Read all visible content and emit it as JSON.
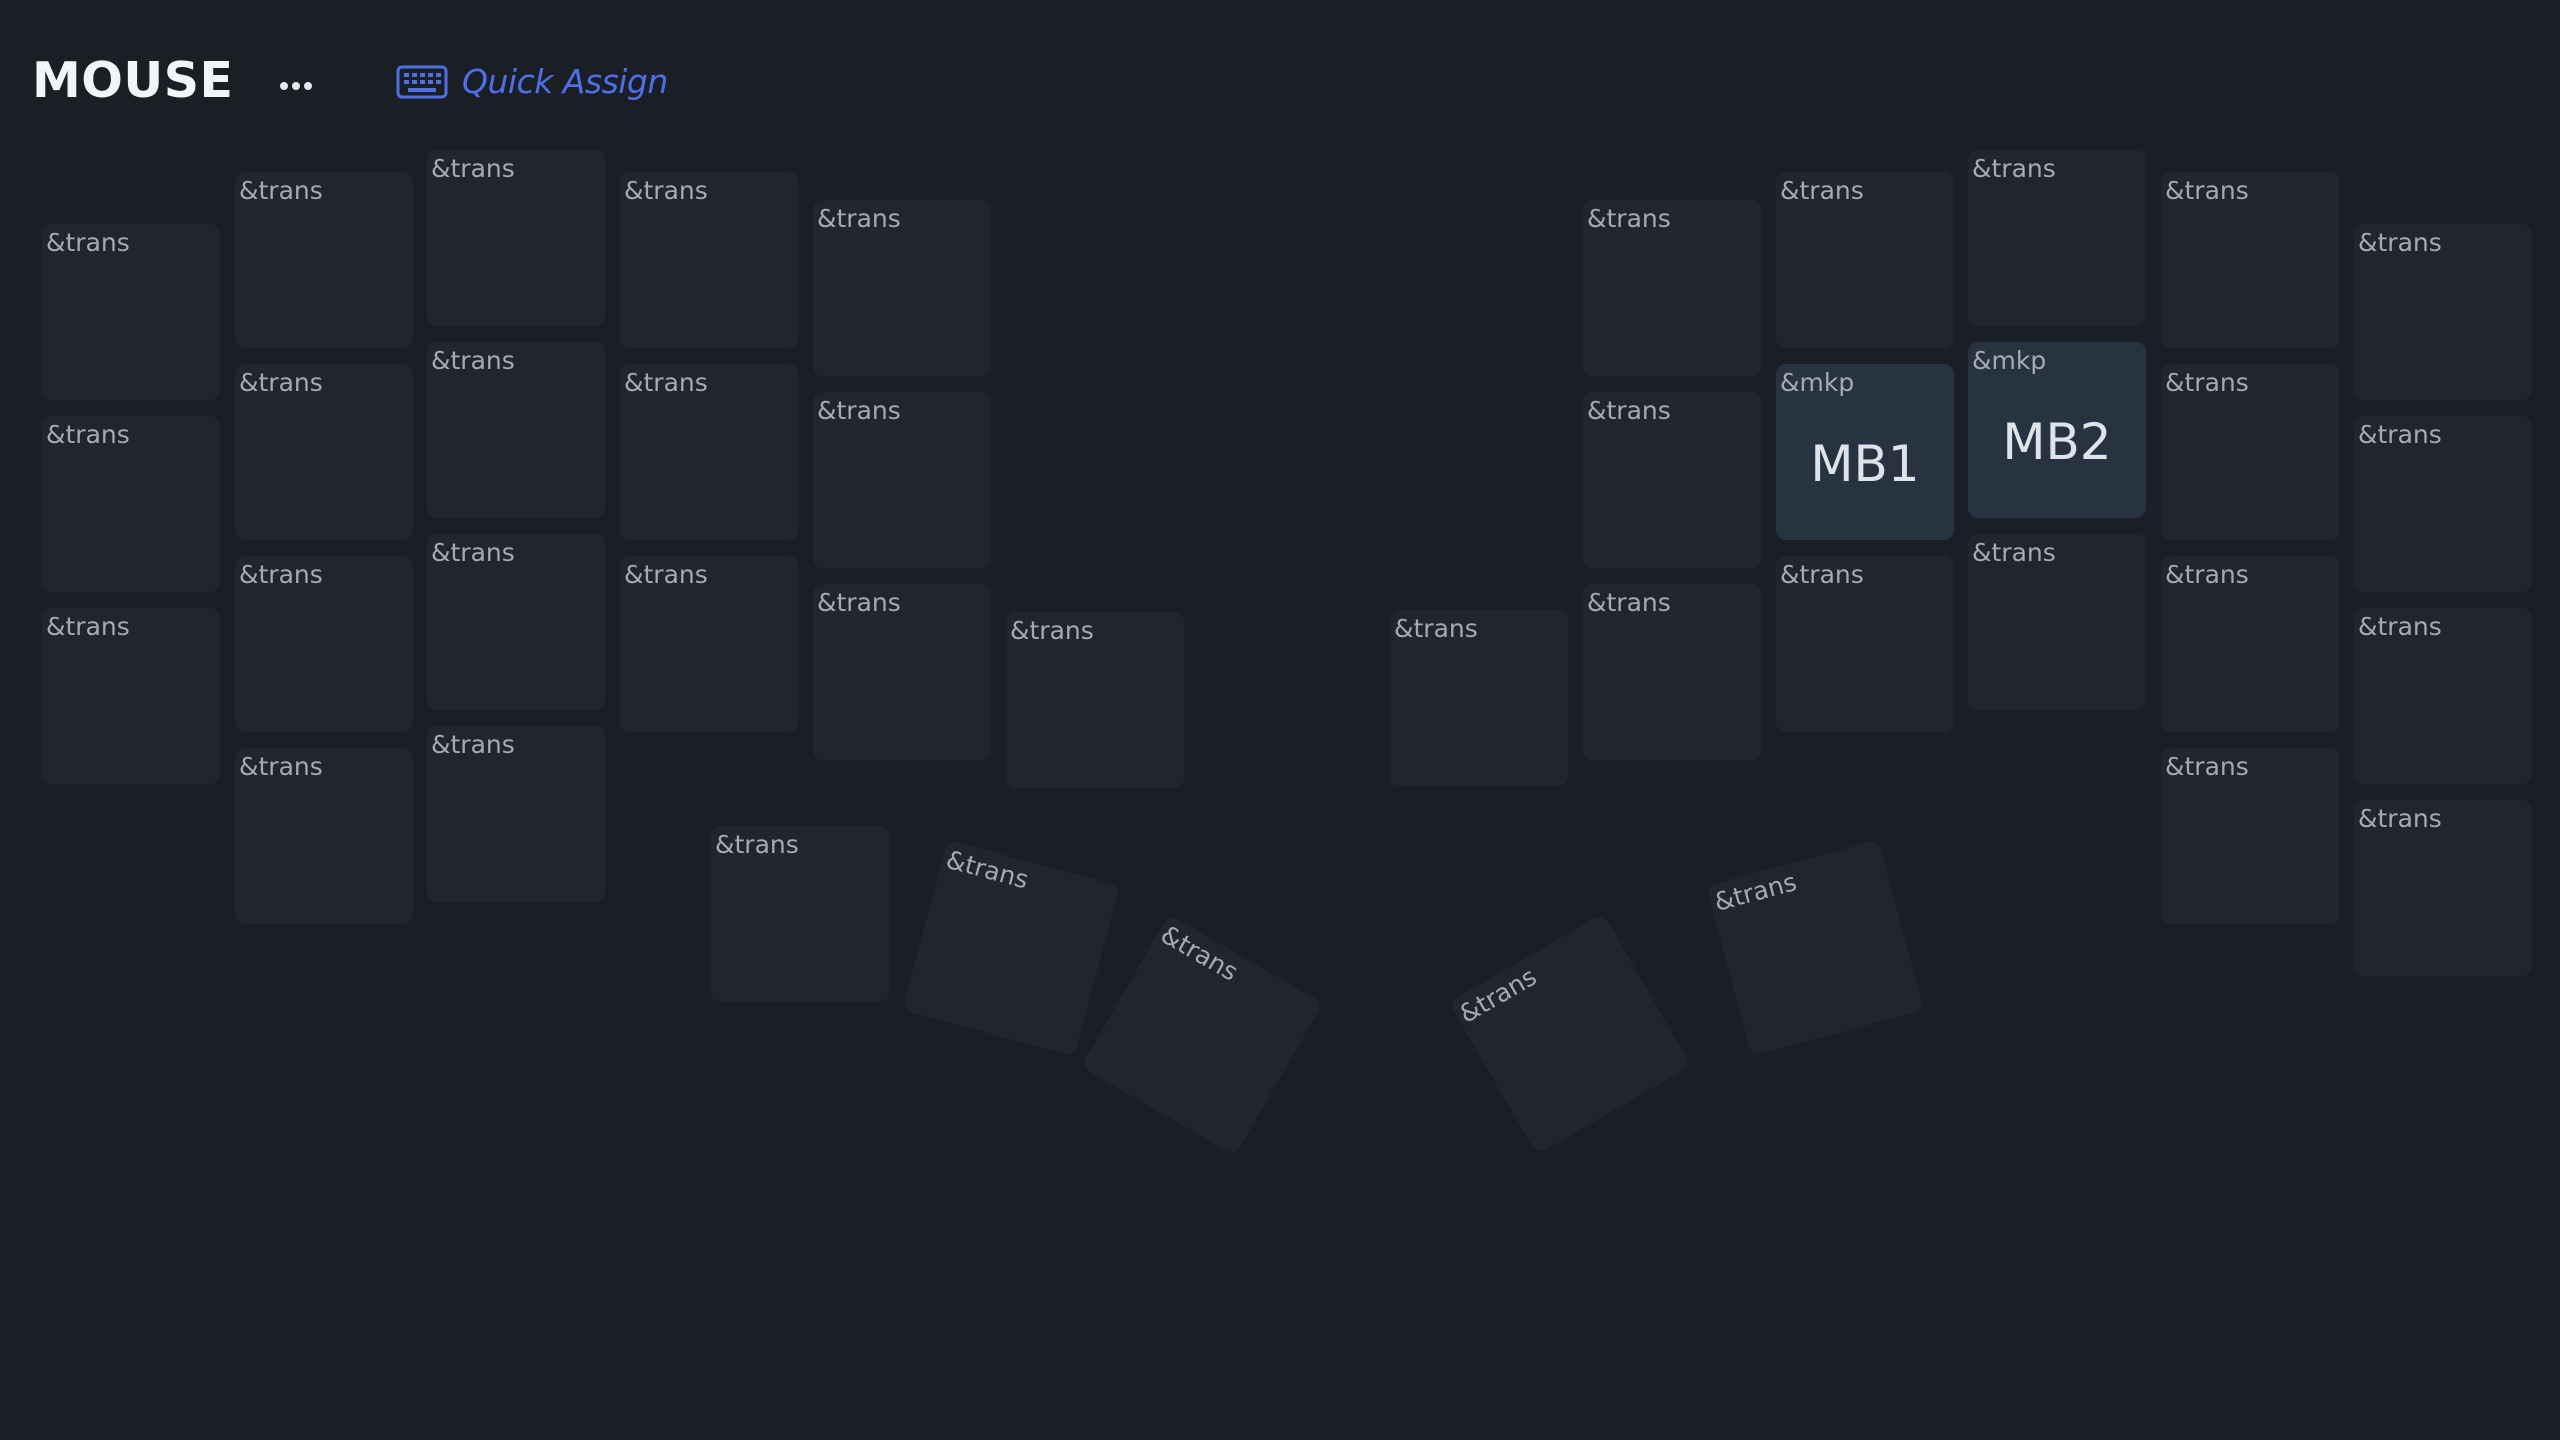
{
  "layer": {
    "name": "MOUSE",
    "more_icon": "ellipsis-icon",
    "quick_assign_label": "Quick Assign",
    "quick_assign_icon": "keyboard-icon",
    "accent_color": "#4f6fe8"
  },
  "keys": [
    {
      "id": "l0-0",
      "label": "&trans",
      "value": ""
    },
    {
      "id": "l1-0",
      "label": "&trans",
      "value": ""
    },
    {
      "id": "l2-0",
      "label": "&trans",
      "value": ""
    },
    {
      "id": "l3-0",
      "label": "&trans",
      "value": ""
    },
    {
      "id": "l4-0",
      "label": "&trans",
      "value": ""
    },
    {
      "id": "l0-1",
      "label": "&trans",
      "value": ""
    },
    {
      "id": "l1-1",
      "label": "&trans",
      "value": ""
    },
    {
      "id": "l2-1",
      "label": "&trans",
      "value": ""
    },
    {
      "id": "l3-1",
      "label": "&trans",
      "value": ""
    },
    {
      "id": "l4-1",
      "label": "&trans",
      "value": ""
    },
    {
      "id": "l0-2",
      "label": "&trans",
      "value": ""
    },
    {
      "id": "l1-2",
      "label": "&trans",
      "value": ""
    },
    {
      "id": "l2-2",
      "label": "&trans",
      "value": ""
    },
    {
      "id": "l3-2",
      "label": "&trans",
      "value": ""
    },
    {
      "id": "l4-2",
      "label": "&trans",
      "value": ""
    },
    {
      "id": "l5-2",
      "label": "&trans",
      "value": ""
    },
    {
      "id": "l1-3",
      "label": "&trans",
      "value": ""
    },
    {
      "id": "l2-3",
      "label": "&trans",
      "value": ""
    },
    {
      "id": "lt-0",
      "label": "&trans",
      "value": ""
    },
    {
      "id": "lt-1",
      "label": "&trans",
      "value": ""
    },
    {
      "id": "lt-2",
      "label": "&trans",
      "value": ""
    },
    {
      "id": "r0-0",
      "label": "&trans",
      "value": ""
    },
    {
      "id": "r1-0",
      "label": "&trans",
      "value": ""
    },
    {
      "id": "r2-0",
      "label": "&trans",
      "value": ""
    },
    {
      "id": "r3-0",
      "label": "&trans",
      "value": ""
    },
    {
      "id": "r4-0",
      "label": "&trans",
      "value": ""
    },
    {
      "id": "r0-1",
      "label": "&trans",
      "value": ""
    },
    {
      "id": "r1-1",
      "label": "&mkp",
      "value": "MB1",
      "active": true
    },
    {
      "id": "r2-1",
      "label": "&mkp",
      "value": "MB2",
      "active": true
    },
    {
      "id": "r3-1",
      "label": "&trans",
      "value": ""
    },
    {
      "id": "r4-1",
      "label": "&trans",
      "value": ""
    },
    {
      "id": "rx-2",
      "label": "&trans",
      "value": ""
    },
    {
      "id": "r0-2",
      "label": "&trans",
      "value": ""
    },
    {
      "id": "r1-2",
      "label": "&trans",
      "value": ""
    },
    {
      "id": "r2-2",
      "label": "&trans",
      "value": ""
    },
    {
      "id": "r3-2",
      "label": "&trans",
      "value": ""
    },
    {
      "id": "r4-2",
      "label": "&trans",
      "value": ""
    },
    {
      "id": "r3-3",
      "label": "&trans",
      "value": ""
    },
    {
      "id": "r4-3",
      "label": "&trans",
      "value": ""
    },
    {
      "id": "rt-0",
      "label": "&trans",
      "value": ""
    },
    {
      "id": "rt-1",
      "label": "&trans",
      "value": ""
    }
  ]
}
